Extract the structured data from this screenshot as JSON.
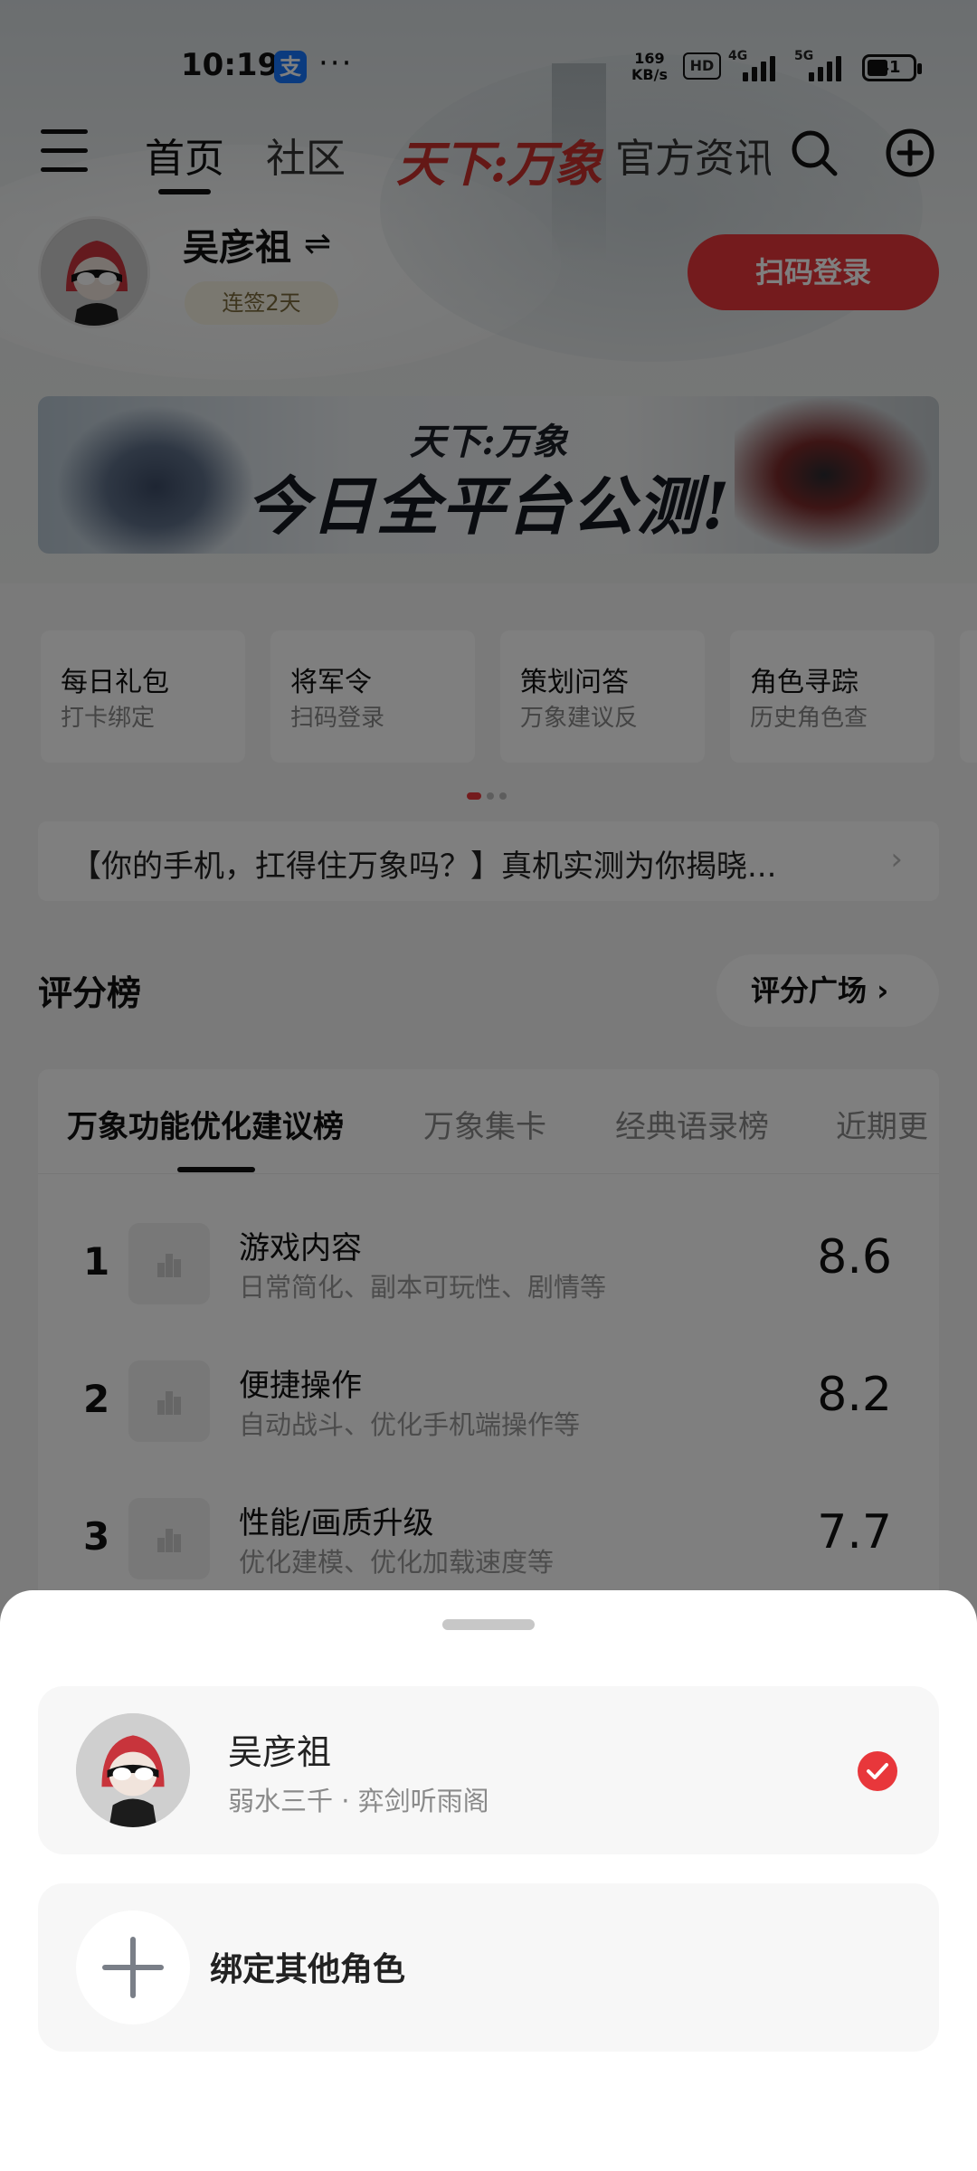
{
  "status_bar": {
    "time": "10:19",
    "alipay_glyph": "支",
    "more": "···",
    "net_speed_value": "169",
    "net_speed_unit": "KB/s",
    "hd": "HD",
    "sig1": "4G",
    "sig2": "5G",
    "battery": "41"
  },
  "nav": {
    "home": "首页",
    "community": "社区",
    "logo": "天下:万象",
    "news": "官方资讯"
  },
  "profile": {
    "name": "吴彦祖",
    "switch": "⇌",
    "streak": "连签2天",
    "scan_login": "扫码登录"
  },
  "banner": {
    "title": "天下:万象",
    "subtitle": "今日全平台公测!"
  },
  "features": [
    {
      "title": "每日礼包",
      "sub": "打卡绑定"
    },
    {
      "title": "将军令",
      "sub": "扫码登录"
    },
    {
      "title": "策划问答",
      "sub": "万象建议反"
    },
    {
      "title": "角色寻踪",
      "sub": "历史角色查"
    }
  ],
  "notice": {
    "text": "【你的手机，扛得住万象吗？】真机实测为你揭晓...",
    "chevron": "›"
  },
  "ranking": {
    "title": "评分榜",
    "plaza": "评分广场 ›",
    "tabs": [
      "万象功能优化建议榜",
      "万象集卡",
      "经典语录榜",
      "近期更"
    ],
    "rows": [
      {
        "rank": "1",
        "title": "游戏内容",
        "sub": "日常简化、副本可玩性、剧情等",
        "score": "8.6"
      },
      {
        "rank": "2",
        "title": "便捷操作",
        "sub": "自动战斗、优化手机端操作等",
        "score": "8.2"
      },
      {
        "rank": "3",
        "title": "性能/画质升级",
        "sub": "优化建模、优化加载速度等",
        "score": "7.7"
      }
    ]
  },
  "sheet": {
    "role_name": "吴彦祖",
    "role_sub": "弱水三千 · 弈剑听雨阁",
    "add_label": "绑定其他角色"
  },
  "colors": {
    "accent_red": "#e8373b",
    "overlay": "rgba(0,0,0,0.5)"
  }
}
